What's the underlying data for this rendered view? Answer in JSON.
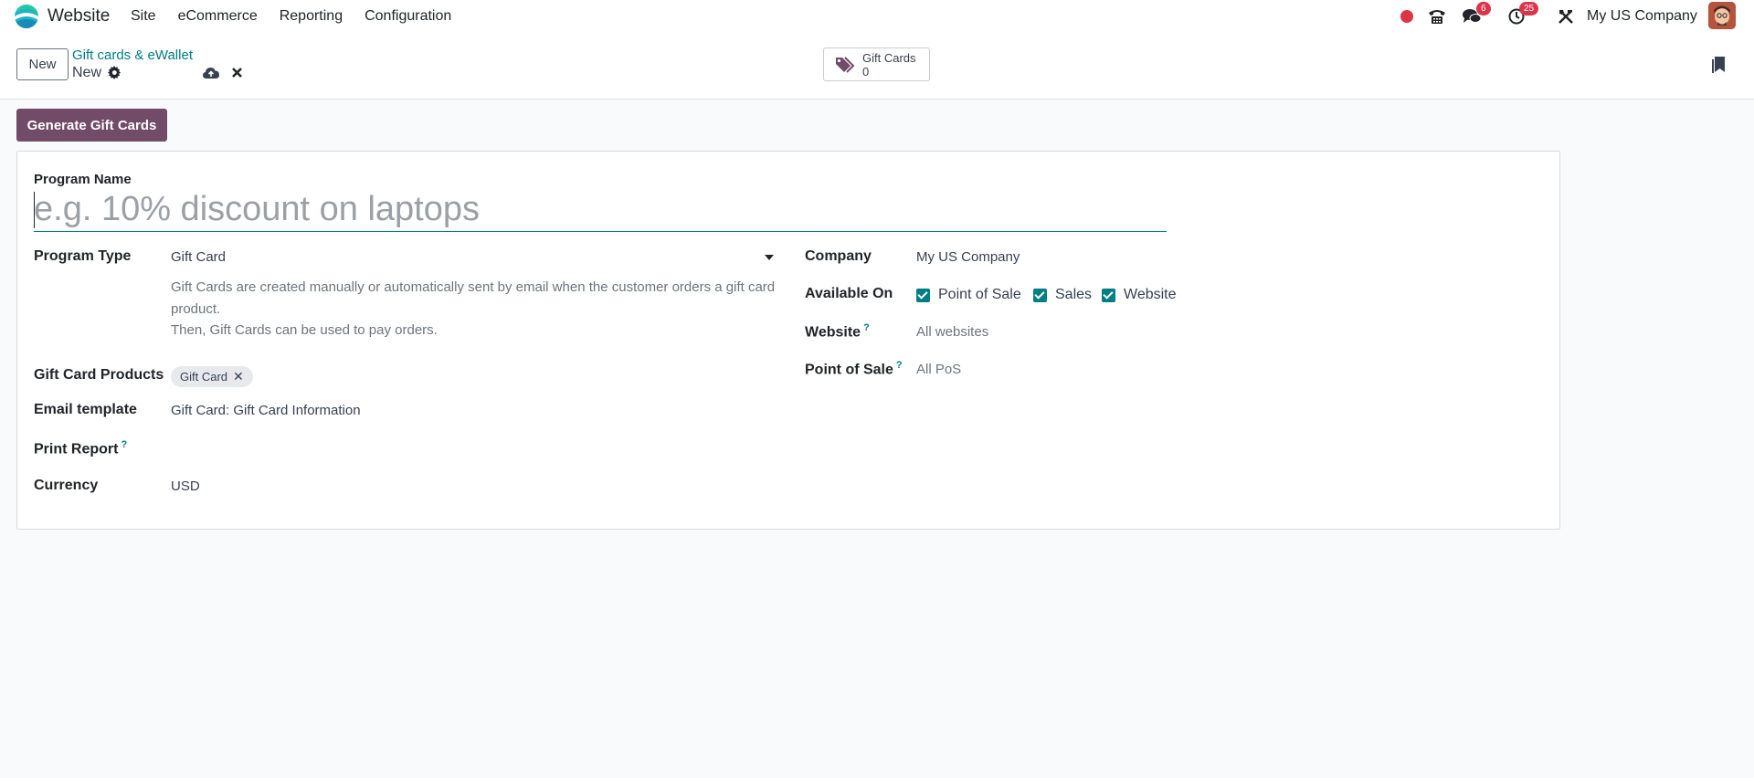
{
  "navbar": {
    "app_name": "Website",
    "menu": [
      "Site",
      "eCommerce",
      "Reporting",
      "Configuration"
    ],
    "messages_count": "6",
    "activities_count": "25",
    "company": "My US Company"
  },
  "control_panel": {
    "new_label": "New",
    "breadcrumb": "Gift cards & eWallet",
    "record_name": "New",
    "smart_button": {
      "label": "Gift Cards",
      "value": "0"
    }
  },
  "actions": {
    "generate_label": "Generate Gift Cards"
  },
  "form": {
    "program_name_label": "Program Name",
    "program_name_placeholder": "e.g. 10% discount on laptops",
    "program_type_label": "Program Type",
    "program_type_value": "Gift Card",
    "description_line1": "Gift Cards are created manually or automatically sent by email when the customer orders a gift card product.",
    "description_line2": "Then, Gift Cards can be used to pay orders.",
    "gift_card_products_label": "Gift Card Products",
    "gift_card_products_tag": "Gift Card",
    "email_template_label": "Email template",
    "email_template_value": "Gift Card: Gift Card Information",
    "print_report_label": "Print Report",
    "currency_label": "Currency",
    "currency_value": "USD",
    "company_label": "Company",
    "company_value": "My US Company",
    "available_on_label": "Available On",
    "available_on": [
      {
        "label": "Point of Sale",
        "checked": true
      },
      {
        "label": "Sales",
        "checked": true
      },
      {
        "label": "Website",
        "checked": true
      }
    ],
    "website_label": "Website",
    "website_placeholder": "All websites",
    "pos_label": "Point of Sale",
    "pos_placeholder": "All PoS",
    "help_mark": "?"
  },
  "colors": {
    "brand": "#714b67",
    "accent": "#017e84",
    "badge": "#d9364b"
  }
}
